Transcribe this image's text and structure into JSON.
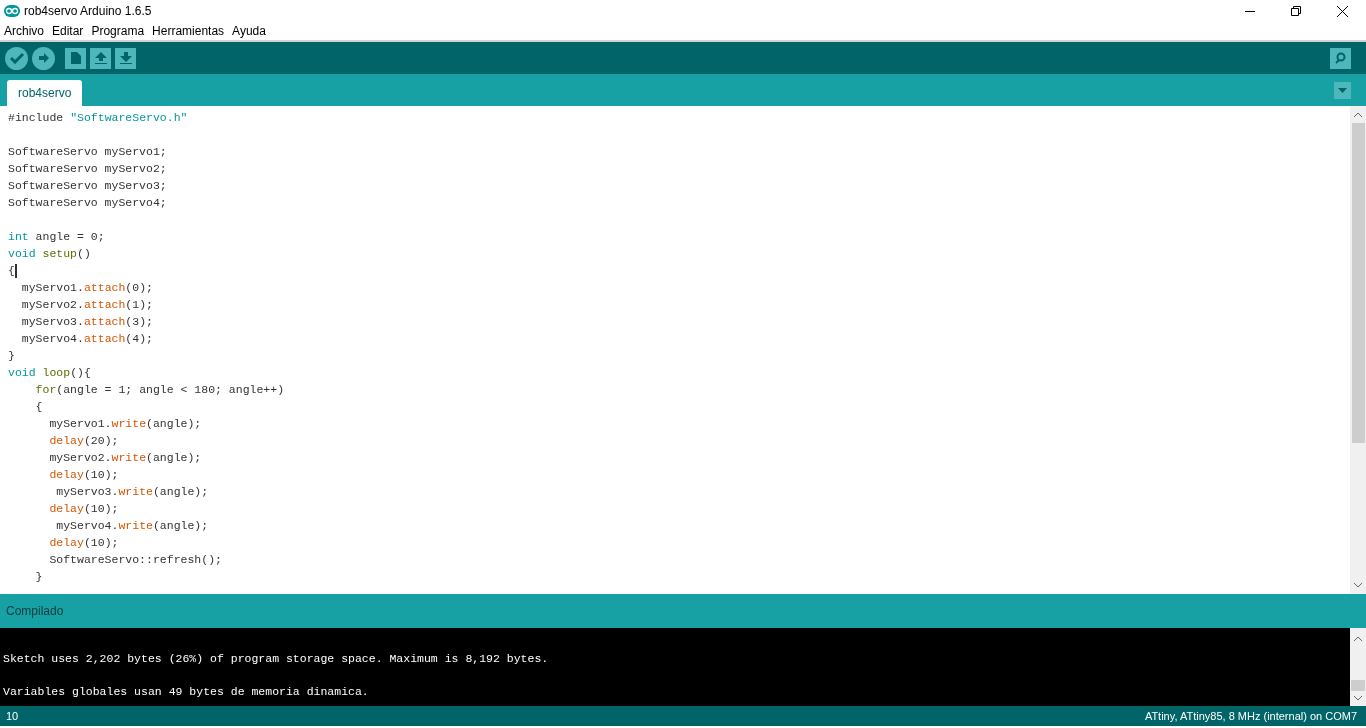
{
  "window": {
    "title": "rob4servo Arduino 1.6.5"
  },
  "menu": [
    "Archivo",
    "Editar",
    "Programa",
    "Herramientas",
    "Ayuda"
  ],
  "toolbar": [
    {
      "kind": "verify"
    },
    {
      "kind": "upload"
    },
    {
      "kind": "new"
    },
    {
      "kind": "open"
    },
    {
      "kind": "save"
    }
  ],
  "tabs": [
    {
      "label": "rob4servo",
      "selected": true
    }
  ],
  "editor": {
    "lines": [
      {
        "kind": "code",
        "tokens": [
          {
            "kind": "plain",
            "text": "#include "
          },
          {
            "kind": "string",
            "text": "\"SoftwareServo.h\""
          }
        ]
      },
      {
        "kind": "blank"
      },
      {
        "kind": "code",
        "tokens": [
          {
            "kind": "plain",
            "text": "SoftwareServo myServo1;"
          }
        ]
      },
      {
        "kind": "code",
        "tokens": [
          {
            "kind": "plain",
            "text": "SoftwareServo myServo2;"
          }
        ]
      },
      {
        "kind": "code",
        "tokens": [
          {
            "kind": "plain",
            "text": "SoftwareServo myServo3;"
          }
        ]
      },
      {
        "kind": "code",
        "tokens": [
          {
            "kind": "plain",
            "text": "SoftwareServo myServo4;"
          }
        ]
      },
      {
        "kind": "blank"
      },
      {
        "kind": "code",
        "tokens": [
          {
            "kind": "keyword",
            "text": "int"
          },
          {
            "kind": "plain",
            "text": " angle = 0;"
          }
        ]
      },
      {
        "kind": "code",
        "tokens": [
          {
            "kind": "keyword",
            "text": "void "
          },
          {
            "kind": "structure",
            "text": "setup"
          },
          {
            "kind": "plain",
            "text": "()"
          }
        ]
      },
      {
        "kind": "code",
        "tokens": [
          {
            "kind": "plain",
            "text": "{"
          }
        ],
        "cursor": true
      },
      {
        "kind": "code",
        "tokens": [
          {
            "kind": "plain",
            "text": "  myServo1."
          },
          {
            "kind": "function",
            "text": "attach"
          },
          {
            "kind": "plain",
            "text": "(0);"
          }
        ]
      },
      {
        "kind": "code",
        "tokens": [
          {
            "kind": "plain",
            "text": "  myServo2."
          },
          {
            "kind": "function",
            "text": "attach"
          },
          {
            "kind": "plain",
            "text": "(1);"
          }
        ]
      },
      {
        "kind": "code",
        "tokens": [
          {
            "kind": "plain",
            "text": "  myServo3."
          },
          {
            "kind": "function",
            "text": "attach"
          },
          {
            "kind": "plain",
            "text": "(3);"
          }
        ]
      },
      {
        "kind": "code",
        "tokens": [
          {
            "kind": "plain",
            "text": "  myServo4."
          },
          {
            "kind": "function",
            "text": "attach"
          },
          {
            "kind": "plain",
            "text": "(4);"
          }
        ]
      },
      {
        "kind": "code",
        "tokens": [
          {
            "kind": "plain",
            "text": "}"
          }
        ]
      },
      {
        "kind": "code",
        "tokens": [
          {
            "kind": "keyword",
            "text": "void "
          },
          {
            "kind": "structure",
            "text": "loop"
          },
          {
            "kind": "plain",
            "text": "(){"
          }
        ]
      },
      {
        "kind": "code",
        "tokens": [
          {
            "kind": "structure",
            "text": "    for"
          },
          {
            "kind": "plain",
            "text": "(angle = 1; angle < 180; angle++)"
          }
        ]
      },
      {
        "kind": "code",
        "tokens": [
          {
            "kind": "plain",
            "text": "    {"
          }
        ]
      },
      {
        "kind": "code",
        "tokens": [
          {
            "kind": "plain",
            "text": "      myServo1."
          },
          {
            "kind": "function",
            "text": "write"
          },
          {
            "kind": "plain",
            "text": "(angle);"
          }
        ]
      },
      {
        "kind": "code",
        "tokens": [
          {
            "kind": "function",
            "text": "      delay"
          },
          {
            "kind": "plain",
            "text": "(20);"
          }
        ]
      },
      {
        "kind": "code",
        "tokens": [
          {
            "kind": "plain",
            "text": "      myServo2."
          },
          {
            "kind": "function",
            "text": "write"
          },
          {
            "kind": "plain",
            "text": "(angle);"
          }
        ]
      },
      {
        "kind": "code",
        "tokens": [
          {
            "kind": "function",
            "text": "      delay"
          },
          {
            "kind": "plain",
            "text": "(10);"
          }
        ]
      },
      {
        "kind": "code",
        "tokens": [
          {
            "kind": "plain",
            "text": "       myServo3."
          },
          {
            "kind": "function",
            "text": "write"
          },
          {
            "kind": "plain",
            "text": "(angle);"
          }
        ]
      },
      {
        "kind": "code",
        "tokens": [
          {
            "kind": "function",
            "text": "      delay"
          },
          {
            "kind": "plain",
            "text": "(10);"
          }
        ]
      },
      {
        "kind": "code",
        "tokens": [
          {
            "kind": "plain",
            "text": "       myServo4."
          },
          {
            "kind": "function",
            "text": "write"
          },
          {
            "kind": "plain",
            "text": "(angle);"
          }
        ]
      },
      {
        "kind": "code",
        "tokens": [
          {
            "kind": "function",
            "text": "      delay"
          },
          {
            "kind": "plain",
            "text": "(10);"
          }
        ]
      },
      {
        "kind": "code",
        "tokens": [
          {
            "kind": "plain",
            "text": "      SoftwareServo::refresh();"
          }
        ]
      },
      {
        "kind": "code",
        "tokens": [
          {
            "kind": "plain",
            "text": "    }"
          }
        ]
      }
    ]
  },
  "console": {
    "header": "Compilado",
    "lines": [
      {
        "kind": "blank"
      },
      {
        "kind": "text",
        "text": "Sketch uses 2,202 bytes (26%) of program storage space. Maximum is 8,192 bytes."
      },
      {
        "kind": "blank"
      },
      {
        "kind": "text",
        "text": "Variables globales usan 49 bytes de memoria dinamica."
      }
    ]
  },
  "status_bar": {
    "line": "10",
    "board": "ATtiny, ATtiny85, 8 MHz (internal) on COM7"
  }
}
